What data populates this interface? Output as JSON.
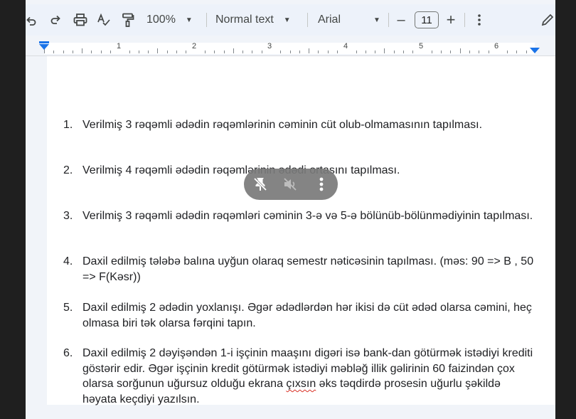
{
  "toolbar": {
    "zoom": "100%",
    "style": "Normal text",
    "font": "Arial",
    "font_size": "11",
    "minus": "–",
    "plus": "+"
  },
  "ruler": {
    "numbers": [
      "1",
      "2",
      "3",
      "4",
      "5",
      "6"
    ]
  },
  "document": {
    "items": [
      {
        "num": "1.",
        "text": "Verilmiş 3 rəqəmli ədədin rəqəmlərinin cəminin cüt olub-olmamasının tapılması."
      },
      {
        "num": "2.",
        "text": "Verilmiş 4 rəqəmli ədədin rəqəmlərinin ədədi ortasını tapılması."
      },
      {
        "num": "3.",
        "text": "Verilmiş 3 rəqəmli ədədin rəqəmləri cəminin 3-ə və 5-ə bölünüb-bölünmədiyinin tapılması."
      },
      {
        "num": "4.",
        "text": "Daxil edilmiş tələbə balına uyğun olaraq semestr nəticəsinin tapılması. (məs: 90 => B , 50 => F(Kəsr))"
      },
      {
        "num": "5.",
        "text": "Daxil edilmiş 2 ədədin yoxlanışı. Əgər ədədlərdən hər ikisi də cüt ədəd olarsa cəmini, heç olmasa biri tək olarsa fərqini tapın."
      },
      {
        "num": "6.",
        "text_before": "Daxil edilmiş 2 dəyişəndən 1-i işçinin maaşını digəri isə bank-dan götürmək istədiyi krediti göstərir edir. Əgər işçinin kredit götürmək istədiyi məbləğ illik gəlirinin 60 faizindən çox olarsa sorğunun uğursuz olduğu ekrana ",
        "text_misspelled": "çıxsın",
        "text_after": " əks təqdirdə prosesin uğurlu şəkildə həyata keçdiyi yazılsın."
      }
    ]
  },
  "colors": {
    "toolbar_bg": "#edf2fa",
    "page_bg": "#ffffff",
    "accent": "#1a73e8",
    "spell_error": "#d93025"
  }
}
